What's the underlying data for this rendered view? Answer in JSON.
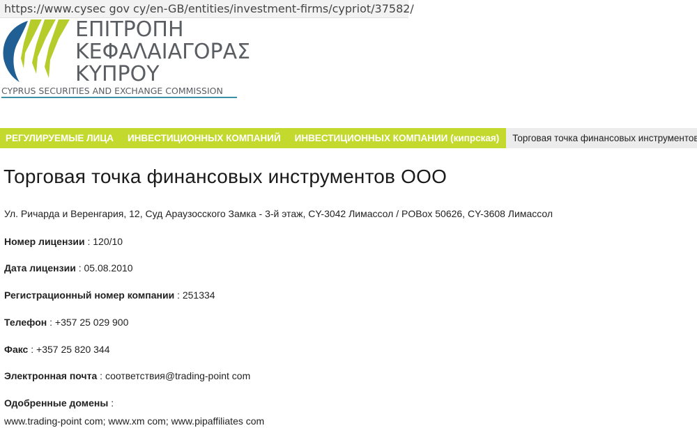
{
  "browser": {
    "url": "https://www.cysec gov cy/en-GB/entities/investment-firms/cypriot/37582/"
  },
  "logo": {
    "greek_lines": [
      "ΕΠΙΤΡΟΠΗ",
      "ΚΕΦΑΛΑΙΑΓΟΡΑΣ",
      "ΚΥΠΡΟΥ"
    ],
    "english": "CYPRUS SECURITIES AND EXCHANGE COMMISSION"
  },
  "nav": {
    "items": [
      "РЕГУЛИРУЕМЫЕ ЛИЦА",
      "ИНВЕСТИЦИОННЫХ КОМПАНИЙ",
      "ИНВЕСТИЦИОННЫХ КОМПАНИИ (кипрская)"
    ],
    "current": "Торговая точка финансовых инструментов ООО"
  },
  "entity": {
    "title": "Торговая точка финансовых инструментов ООО",
    "address": "Ул. Ричарда и Веренгария, 12, Суд Араузосского Замка - 3-й этаж, CY-3042 Лимассол / POBox 50626, CY-3608 Лимассол",
    "license_number": {
      "label": "Номер лицензии",
      "value": "120/10"
    },
    "license_date": {
      "label": "Дата лицензии",
      "value": "05.08.2010"
    },
    "registration_number": {
      "label": "Регистрационный номер компании",
      "value": "251334"
    },
    "phone": {
      "label": "Телефон",
      "value": "+357 25 029 900"
    },
    "fax": {
      "label": "Факс",
      "value": "+357 25 820 344"
    },
    "email": {
      "label": "Электронная почта",
      "value": "соответствия@trading-point com"
    },
    "domains": {
      "label": "Одобренные домены",
      "value": "www.trading-point com; www.xm com; www.pipaffiliates com"
    }
  },
  "colors": {
    "nav_green": "#c4d92e",
    "logo_blue": "#1f5f94",
    "logo_green": "#b5cc2a",
    "logo_gray": "#5a5e62",
    "logo_teal": "#3b8fa5"
  }
}
